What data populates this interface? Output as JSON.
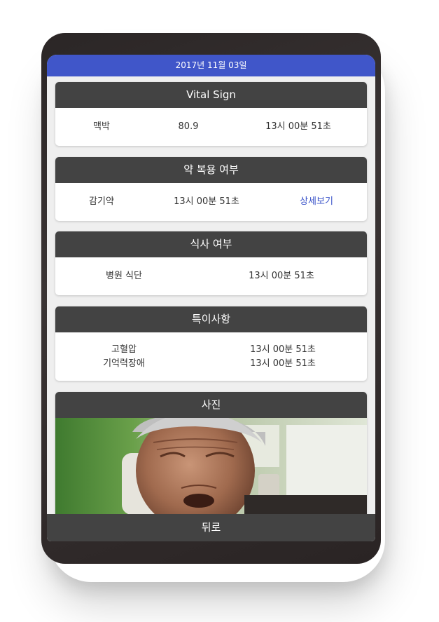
{
  "header": {
    "date": "2017년 11월 03일"
  },
  "vital": {
    "title": "Vital Sign",
    "name": "맥박",
    "value": "80.9",
    "time": "13시 00분 51초"
  },
  "medication": {
    "title": "약 복용 여부",
    "name": "감기약",
    "time": "13시 00분 51초",
    "detail_link": "상세보기"
  },
  "meal": {
    "title": "식사 여부",
    "name": "병원 식단",
    "time": "13시 00분 51초"
  },
  "notes": {
    "title": "특이사항",
    "items": [
      {
        "name": "고혈압",
        "time": "13시 00분 51초"
      },
      {
        "name": "기억력장애",
        "time": "13시 00분 51초"
      }
    ]
  },
  "photo": {
    "title": "사진"
  },
  "footer": {
    "back_label": "뒤로"
  },
  "colors": {
    "accent": "#4056c9",
    "header_bg": "#434343",
    "link": "#3a53c9"
  }
}
